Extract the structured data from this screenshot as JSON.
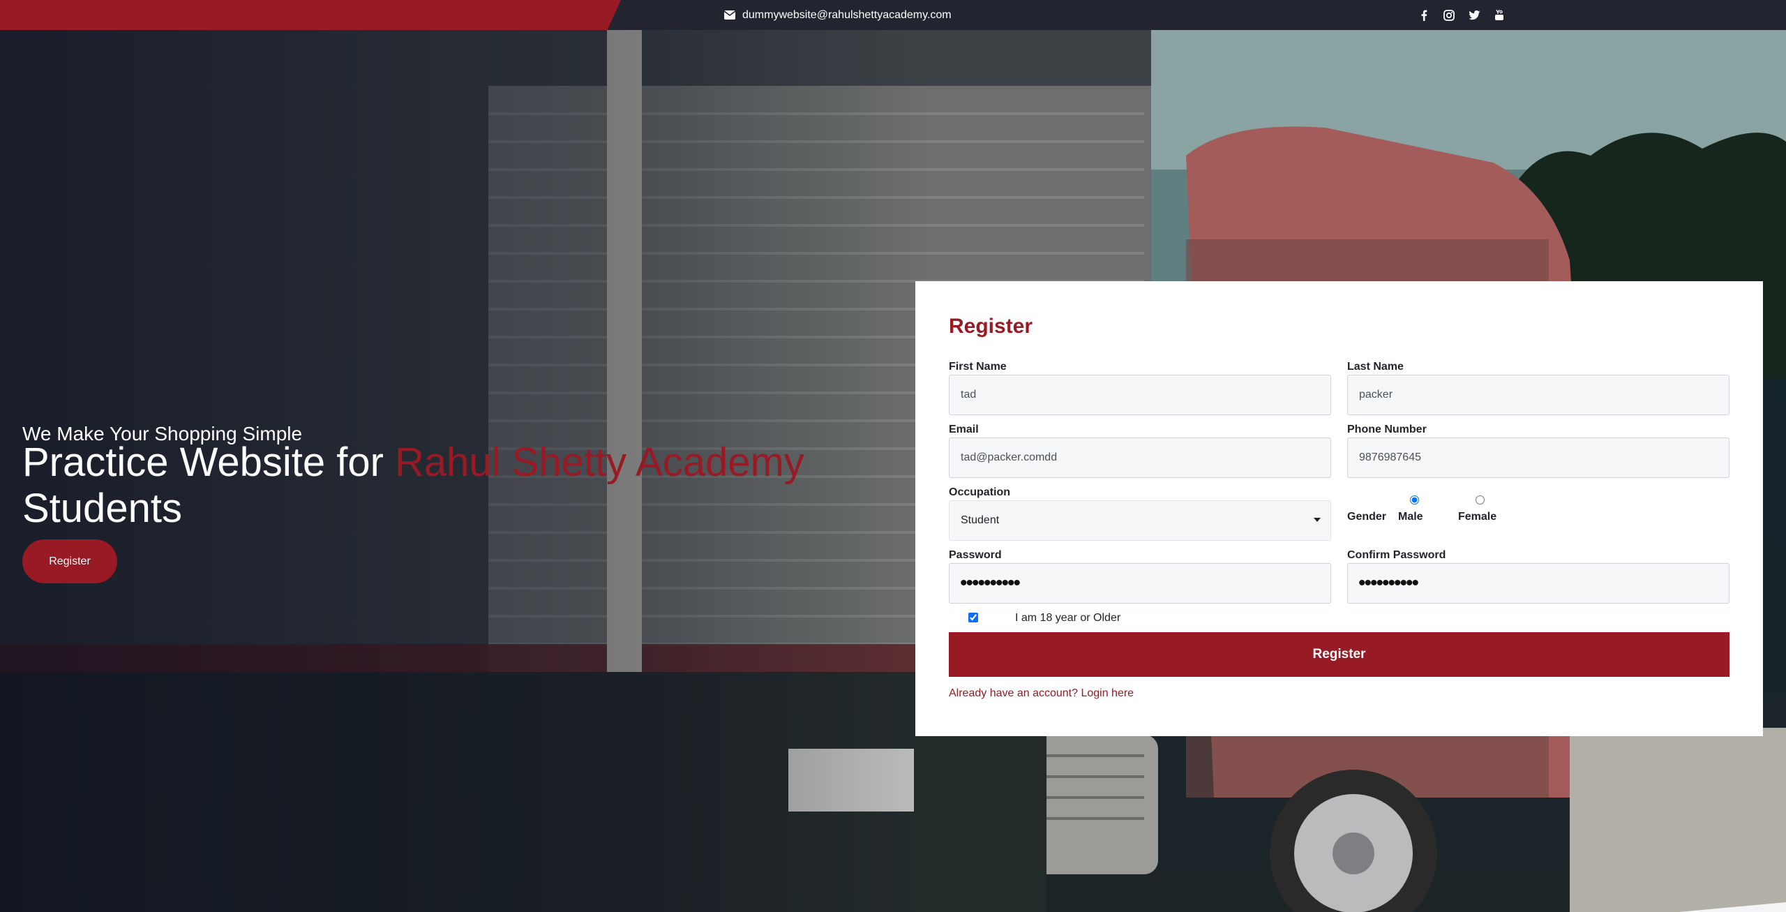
{
  "topbar": {
    "email": "dummywebsite@rahulshettyacademy.com",
    "socials": [
      "facebook-icon",
      "instagram-icon",
      "twitter-icon",
      "youtube-icon"
    ]
  },
  "hero": {
    "tagline": "We Make Your Shopping Simple",
    "headline_prefix": "Practice Website for ",
    "headline_accent": "Rahul Shetty Academy",
    "headline_suffix": "Students",
    "button_label": "Register"
  },
  "form": {
    "title": "Register",
    "first_name": {
      "label": "First Name",
      "value": "tad"
    },
    "last_name": {
      "label": "Last Name",
      "value": "packer"
    },
    "email": {
      "label": "Email",
      "value": "tad@packer.comdd"
    },
    "phone": {
      "label": "Phone Number",
      "value": "9876987645"
    },
    "occupation": {
      "label": "Occupation",
      "selected": "Student"
    },
    "gender": {
      "label": "Gender",
      "options": [
        "Male",
        "Female"
      ],
      "selected": "Male"
    },
    "password": {
      "label": "Password",
      "masked": "••••••••••"
    },
    "confirm_password": {
      "label": "Confirm Password",
      "masked": "••••••••••"
    },
    "age_check": {
      "label": "I am 18 year or Older",
      "checked": true
    },
    "submit_label": "Register",
    "login_link": "Already have an account? Login here"
  },
  "colors": {
    "brand_red": "#971a24",
    "topbar_dark": "#22252f"
  }
}
